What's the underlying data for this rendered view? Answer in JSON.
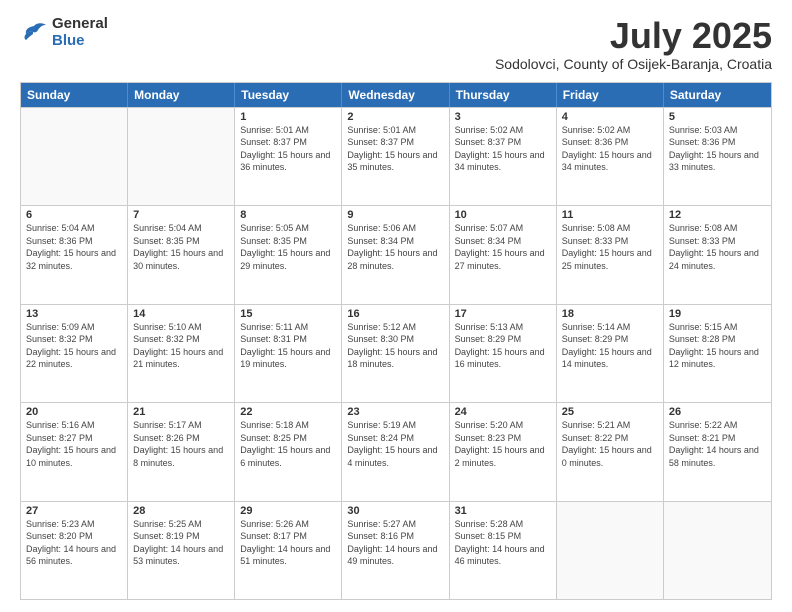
{
  "logo": {
    "line1": "General",
    "line2": "Blue"
  },
  "title": "July 2025",
  "subtitle": "Sodolovci, County of Osijek-Baranja, Croatia",
  "header_days": [
    "Sunday",
    "Monday",
    "Tuesday",
    "Wednesday",
    "Thursday",
    "Friday",
    "Saturday"
  ],
  "weeks": [
    [
      {
        "day": "",
        "info": ""
      },
      {
        "day": "",
        "info": ""
      },
      {
        "day": "1",
        "info": "Sunrise: 5:01 AM\nSunset: 8:37 PM\nDaylight: 15 hours and 36 minutes."
      },
      {
        "day": "2",
        "info": "Sunrise: 5:01 AM\nSunset: 8:37 PM\nDaylight: 15 hours and 35 minutes."
      },
      {
        "day": "3",
        "info": "Sunrise: 5:02 AM\nSunset: 8:37 PM\nDaylight: 15 hours and 34 minutes."
      },
      {
        "day": "4",
        "info": "Sunrise: 5:02 AM\nSunset: 8:36 PM\nDaylight: 15 hours and 34 minutes."
      },
      {
        "day": "5",
        "info": "Sunrise: 5:03 AM\nSunset: 8:36 PM\nDaylight: 15 hours and 33 minutes."
      }
    ],
    [
      {
        "day": "6",
        "info": "Sunrise: 5:04 AM\nSunset: 8:36 PM\nDaylight: 15 hours and 32 minutes."
      },
      {
        "day": "7",
        "info": "Sunrise: 5:04 AM\nSunset: 8:35 PM\nDaylight: 15 hours and 30 minutes."
      },
      {
        "day": "8",
        "info": "Sunrise: 5:05 AM\nSunset: 8:35 PM\nDaylight: 15 hours and 29 minutes."
      },
      {
        "day": "9",
        "info": "Sunrise: 5:06 AM\nSunset: 8:34 PM\nDaylight: 15 hours and 28 minutes."
      },
      {
        "day": "10",
        "info": "Sunrise: 5:07 AM\nSunset: 8:34 PM\nDaylight: 15 hours and 27 minutes."
      },
      {
        "day": "11",
        "info": "Sunrise: 5:08 AM\nSunset: 8:33 PM\nDaylight: 15 hours and 25 minutes."
      },
      {
        "day": "12",
        "info": "Sunrise: 5:08 AM\nSunset: 8:33 PM\nDaylight: 15 hours and 24 minutes."
      }
    ],
    [
      {
        "day": "13",
        "info": "Sunrise: 5:09 AM\nSunset: 8:32 PM\nDaylight: 15 hours and 22 minutes."
      },
      {
        "day": "14",
        "info": "Sunrise: 5:10 AM\nSunset: 8:32 PM\nDaylight: 15 hours and 21 minutes."
      },
      {
        "day": "15",
        "info": "Sunrise: 5:11 AM\nSunset: 8:31 PM\nDaylight: 15 hours and 19 minutes."
      },
      {
        "day": "16",
        "info": "Sunrise: 5:12 AM\nSunset: 8:30 PM\nDaylight: 15 hours and 18 minutes."
      },
      {
        "day": "17",
        "info": "Sunrise: 5:13 AM\nSunset: 8:29 PM\nDaylight: 15 hours and 16 minutes."
      },
      {
        "day": "18",
        "info": "Sunrise: 5:14 AM\nSunset: 8:29 PM\nDaylight: 15 hours and 14 minutes."
      },
      {
        "day": "19",
        "info": "Sunrise: 5:15 AM\nSunset: 8:28 PM\nDaylight: 15 hours and 12 minutes."
      }
    ],
    [
      {
        "day": "20",
        "info": "Sunrise: 5:16 AM\nSunset: 8:27 PM\nDaylight: 15 hours and 10 minutes."
      },
      {
        "day": "21",
        "info": "Sunrise: 5:17 AM\nSunset: 8:26 PM\nDaylight: 15 hours and 8 minutes."
      },
      {
        "day": "22",
        "info": "Sunrise: 5:18 AM\nSunset: 8:25 PM\nDaylight: 15 hours and 6 minutes."
      },
      {
        "day": "23",
        "info": "Sunrise: 5:19 AM\nSunset: 8:24 PM\nDaylight: 15 hours and 4 minutes."
      },
      {
        "day": "24",
        "info": "Sunrise: 5:20 AM\nSunset: 8:23 PM\nDaylight: 15 hours and 2 minutes."
      },
      {
        "day": "25",
        "info": "Sunrise: 5:21 AM\nSunset: 8:22 PM\nDaylight: 15 hours and 0 minutes."
      },
      {
        "day": "26",
        "info": "Sunrise: 5:22 AM\nSunset: 8:21 PM\nDaylight: 14 hours and 58 minutes."
      }
    ],
    [
      {
        "day": "27",
        "info": "Sunrise: 5:23 AM\nSunset: 8:20 PM\nDaylight: 14 hours and 56 minutes."
      },
      {
        "day": "28",
        "info": "Sunrise: 5:25 AM\nSunset: 8:19 PM\nDaylight: 14 hours and 53 minutes."
      },
      {
        "day": "29",
        "info": "Sunrise: 5:26 AM\nSunset: 8:17 PM\nDaylight: 14 hours and 51 minutes."
      },
      {
        "day": "30",
        "info": "Sunrise: 5:27 AM\nSunset: 8:16 PM\nDaylight: 14 hours and 49 minutes."
      },
      {
        "day": "31",
        "info": "Sunrise: 5:28 AM\nSunset: 8:15 PM\nDaylight: 14 hours and 46 minutes."
      },
      {
        "day": "",
        "info": ""
      },
      {
        "day": "",
        "info": ""
      }
    ]
  ]
}
